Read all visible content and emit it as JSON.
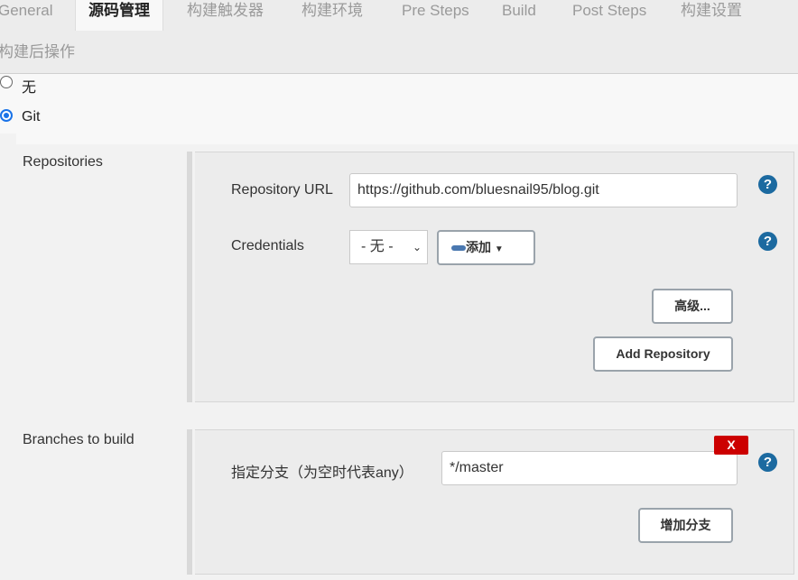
{
  "tabs": [
    {
      "label": "General"
    },
    {
      "label": "源码管理",
      "active": true
    },
    {
      "label": "构建触发器"
    },
    {
      "label": "构建环境"
    },
    {
      "label": "Pre Steps"
    },
    {
      "label": "Build"
    },
    {
      "label": "Post Steps"
    },
    {
      "label": "构建设置"
    },
    {
      "label": "构建后操作"
    }
  ],
  "scm": {
    "options": [
      {
        "label": "无",
        "selected": false
      },
      {
        "label": "Git",
        "selected": true
      }
    ]
  },
  "repositories": {
    "label": "Repositories",
    "url_label": "Repository URL",
    "url_value": "https://github.com/bluesnail95/blog.git",
    "credentials_label": "Credentials",
    "credentials_value": "- 无 -",
    "add_label": "添加",
    "advanced_label": "高级...",
    "add_repository_label": "Add Repository"
  },
  "branches": {
    "label": "Branches to build",
    "spec_label": "指定分支（为空时代表any）",
    "spec_value": "*/master",
    "delete_label": "X",
    "add_branch_label": "增加分支"
  },
  "help_label": "?",
  "colors": {
    "accent": "#1a73e8",
    "help": "#1c6aa0",
    "delete": "#cc0000"
  }
}
